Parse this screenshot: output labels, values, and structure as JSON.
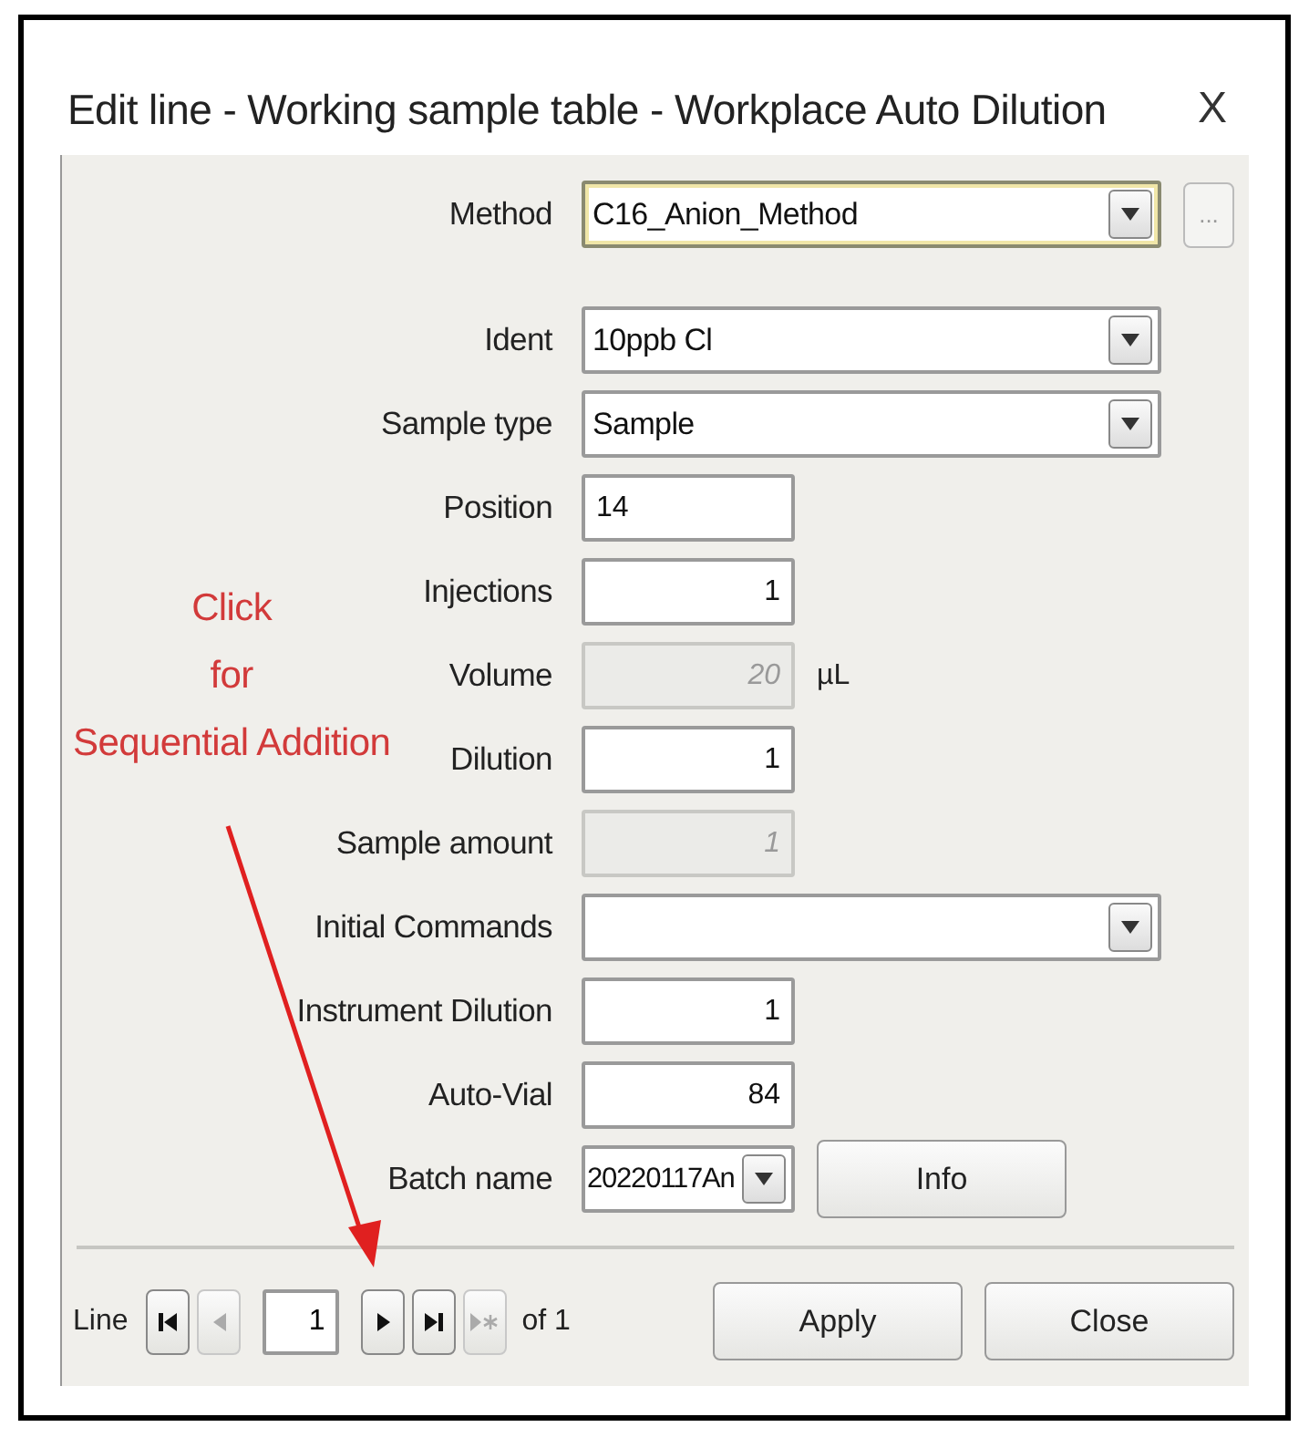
{
  "window": {
    "title": "Edit line - Working sample table - Workplace Auto Dilution",
    "close": "X"
  },
  "fields": [
    {
      "kind": "combo",
      "label": "Method",
      "value": "C16_Anion_Method",
      "focused": true,
      "extra": "..."
    },
    {
      "kind": "combo",
      "label": "Ident",
      "value": "10ppb Cl",
      "focused": false
    },
    {
      "kind": "combo",
      "label": "Sample type",
      "value": "Sample",
      "focused": false
    },
    {
      "kind": "text",
      "label": "Position",
      "value": "14"
    },
    {
      "kind": "number",
      "label": "Injections",
      "value": "1"
    },
    {
      "kind": "readonly",
      "label": "Volume",
      "value": "20",
      "unit": "µL"
    },
    {
      "kind": "number",
      "label": "Dilution",
      "value": "1"
    },
    {
      "kind": "readonly",
      "label": "Sample amount",
      "value": "1"
    },
    {
      "kind": "combo",
      "label": "Initial Commands",
      "focused": false
    },
    {
      "kind": "number",
      "label": "Instrument Dilution",
      "value": "1"
    },
    {
      "kind": "number",
      "label": "Auto-Vial",
      "value": "84"
    },
    {
      "kind": "batch",
      "label": "Batch name",
      "value": "20220117An",
      "button": "Info"
    }
  ],
  "annotation": {
    "lines": [
      "Click",
      "for",
      "Sequential Addition"
    ]
  },
  "footer": {
    "label": "Line",
    "nav": [
      {
        "kind": "first",
        "disabled": false
      },
      {
        "kind": "prev",
        "disabled": true
      },
      {
        "kind": "page",
        "value": "1"
      },
      {
        "kind": "next",
        "disabled": false
      },
      {
        "kind": "last",
        "disabled": false
      },
      {
        "kind": "new",
        "disabled": true
      }
    ],
    "total": "of 1",
    "buttons": [
      "Apply",
      "Close"
    ]
  }
}
